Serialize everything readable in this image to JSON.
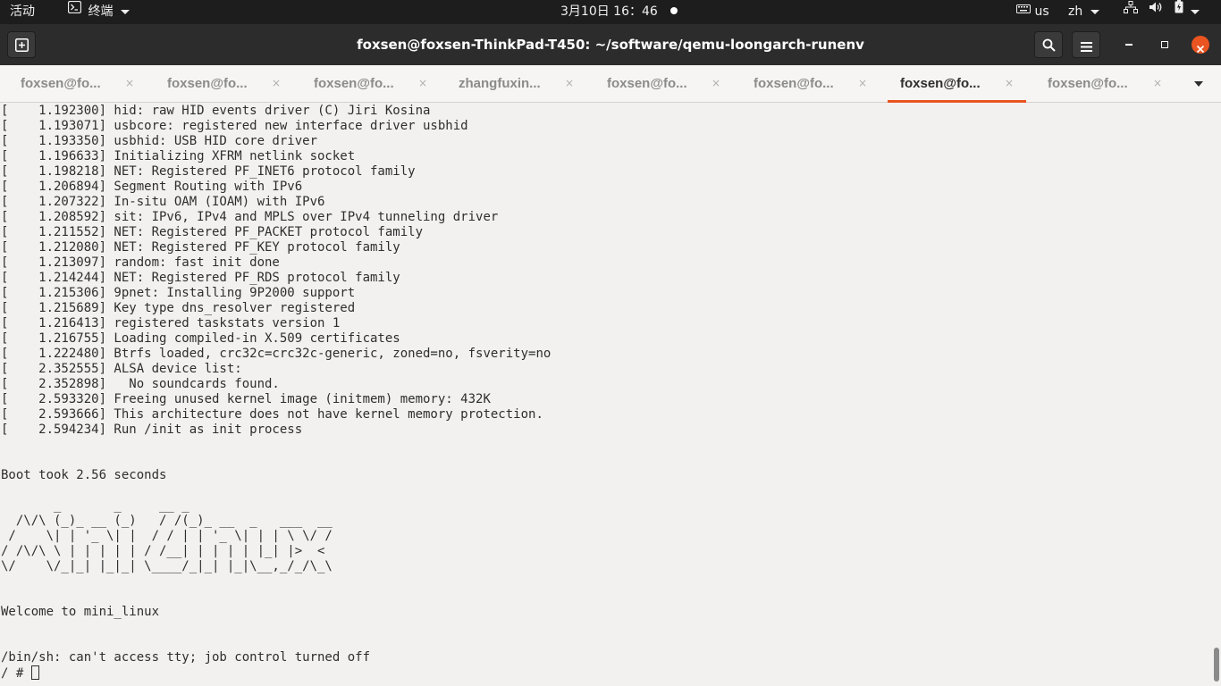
{
  "topbar": {
    "activities": "活动",
    "app_name": "终端",
    "clock": "3月10日 16：46",
    "keyboard_layout": "us",
    "input_method": "zh"
  },
  "window": {
    "title": "foxsen@foxsen-ThinkPad-T450: ~/software/qemu-loongarch-runenv"
  },
  "tabs": [
    {
      "label": "foxsen@fo...",
      "active": false
    },
    {
      "label": "foxsen@fo...",
      "active": false
    },
    {
      "label": "foxsen@fo...",
      "active": false
    },
    {
      "label": "zhangfuxin...",
      "active": false
    },
    {
      "label": "foxsen@fo...",
      "active": false
    },
    {
      "label": "foxsen@fo...",
      "active": false
    },
    {
      "label": "foxsen@fo...",
      "active": true
    },
    {
      "label": "foxsen@fo...",
      "active": false
    }
  ],
  "tab_close_glyph": "×",
  "terminal": {
    "lines": [
      "[    1.192300] hid: raw HID events driver (C) Jiri Kosina",
      "[    1.193071] usbcore: registered new interface driver usbhid",
      "[    1.193350] usbhid: USB HID core driver",
      "[    1.196633] Initializing XFRM netlink socket",
      "[    1.198218] NET: Registered PF_INET6 protocol family",
      "[    1.206894] Segment Routing with IPv6",
      "[    1.207322] In-situ OAM (IOAM) with IPv6",
      "[    1.208592] sit: IPv6, IPv4 and MPLS over IPv4 tunneling driver",
      "[    1.211552] NET: Registered PF_PACKET protocol family",
      "[    1.212080] NET: Registered PF_KEY protocol family",
      "[    1.213097] random: fast init done",
      "[    1.214244] NET: Registered PF_RDS protocol family",
      "[    1.215306] 9pnet: Installing 9P2000 support",
      "[    1.215689] Key type dns_resolver registered",
      "[    1.216413] registered taskstats version 1",
      "[    1.216755] Loading compiled-in X.509 certificates",
      "[    1.222480] Btrfs loaded, crc32c=crc32c-generic, zoned=no, fsverity=no",
      "[    2.352555] ALSA device list:",
      "[    2.352898]   No soundcards found.",
      "[    2.593320] Freeing unused kernel image (initmem) memory: 432K",
      "[    2.593666] This architecture does not have kernel memory protection.",
      "[    2.594234] Run /init as init process",
      "",
      "",
      "Boot took 2.56 seconds",
      "",
      "       _       _     __ _",
      "  /\\/\\ (_)_ __ (_)   / /(_)_ __  _   ___  __",
      " /    \\| | '_ \\| |  / / | | '_ \\| | | \\ \\/ /",
      "/ /\\/\\ \\ | | | | | / /__| | | | | |_| |>  <",
      "\\/    \\/_|_| |_|_| \\____/_|_| |_|\\__,_/_/\\_\\",
      "",
      "",
      "Welcome to mini_linux",
      "",
      "",
      "/bin/sh: can't access tty; job control turned off"
    ],
    "prompt": "/ # "
  },
  "colors": {
    "topbar_bg": "#1d1d1d",
    "headerbar_bg": "#2c2c2c",
    "tab_accent": "#e95420",
    "terminal_bg": "#f2f1f0",
    "terminal_fg": "#2e2e2e",
    "close_button": "#e95420"
  },
  "icons": {
    "app": "terminal-icon",
    "keyboard": "keyboard-icon",
    "network": "network-icon",
    "volume": "volume-icon",
    "battery": "battery-icon",
    "new_tab": "new-tab-icon",
    "search": "search-icon",
    "menu": "hamburger-menu-icon",
    "minimize": "minimize-icon",
    "maximize": "maximize-icon",
    "close": "close-icon",
    "tab_overflow": "chevron-down-icon"
  }
}
